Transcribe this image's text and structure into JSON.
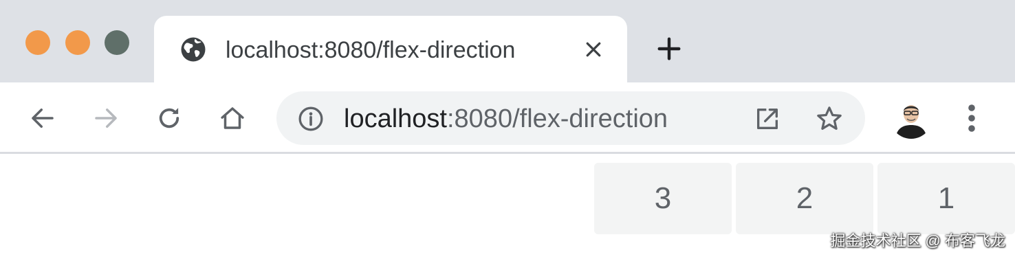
{
  "window": {
    "title": "localhost:8080/flex-direction",
    "colors": {
      "close": "#f2994a",
      "minimize": "#f2994a",
      "maximize": "#5f6f69",
      "tabstrip": "#dee1e6"
    }
  },
  "tab": {
    "icon": "globe-icon",
    "title": "localhost:8080/flex-direction",
    "close_icon": "close-icon"
  },
  "new_tab": {
    "icon": "plus-icon"
  },
  "toolbar": {
    "back_icon": "arrow-left-icon",
    "forward_icon": "arrow-right-icon",
    "reload_icon": "reload-icon",
    "home_icon": "home-icon",
    "omnibox": {
      "info_icon": "info-icon",
      "url_host": "localhost",
      "url_rest": ":8080/flex-direction",
      "open_icon": "open-in-new-icon",
      "bookmark_icon": "star-icon"
    },
    "profile": "avatar",
    "menu_icon": "more-vertical-icon"
  },
  "page": {
    "items": [
      "3",
      "2",
      "1"
    ]
  },
  "watermark": "掘金技术社区 @ 布客飞龙"
}
